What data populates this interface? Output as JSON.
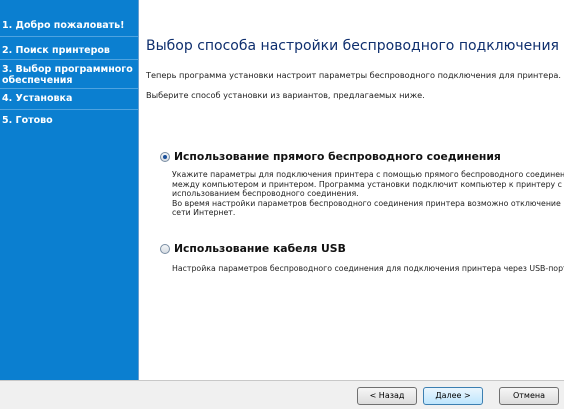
{
  "sidebar": {
    "steps": [
      {
        "label": "1. Добро пожаловать!"
      },
      {
        "label": "2. Поиск принтеров"
      },
      {
        "label_line1": "3. Выбор программного",
        "label_line2": "обеспечения"
      },
      {
        "label": "4. Установка"
      },
      {
        "label": "5. Готово"
      }
    ]
  },
  "main": {
    "title": "Выбор способа настройки беспроводного подключения",
    "intro1": "Теперь программа установки настроит параметры беспроводного подключения для принтера.",
    "intro2": "Выберите способ установки из вариантов, предлагаемых ниже.",
    "options": [
      {
        "label": "Использование прямого беспроводного соединения",
        "selected": true,
        "desc": [
          "Укажите параметры для подключения принтера с помощью прямого беспроводного соединения",
          "между компьютером и принтером. Программа установки подключит компьютер к принтеру с",
          "использованием беспроводного соединения.",
          "Во время настройки параметров беспроводного соединения принтера возможно отключение",
          "сети Интернет."
        ]
      },
      {
        "label": "Использование кабеля USB",
        "selected": false,
        "desc": [
          "Настройка параметров беспроводного соединения для подключения принтера через USB-порт"
        ]
      }
    ]
  },
  "footer": {
    "back_label": "< Назад",
    "next_label": "Далее >",
    "cancel_label": "Отмена"
  }
}
